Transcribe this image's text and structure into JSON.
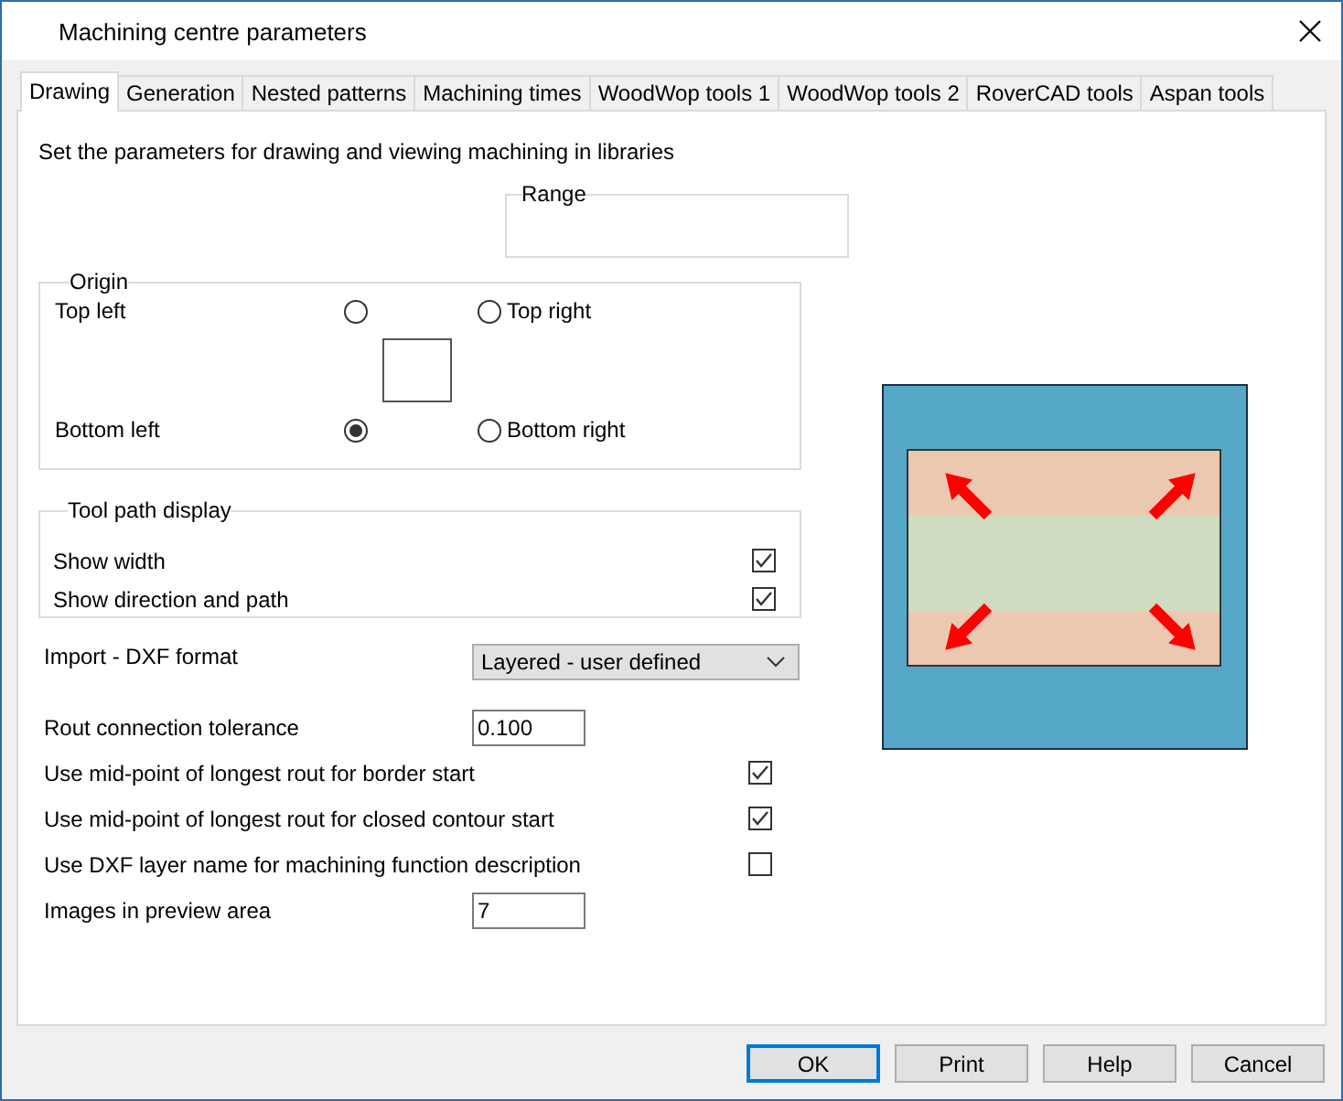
{
  "window": {
    "title": "Machining centre parameters"
  },
  "tabs": [
    {
      "label": "Drawing",
      "selected": true
    },
    {
      "label": "Generation",
      "selected": false
    },
    {
      "label": "Nested patterns",
      "selected": false
    },
    {
      "label": "Machining times",
      "selected": false
    },
    {
      "label": "WoodWop tools 1",
      "selected": false
    },
    {
      "label": "WoodWop tools 2",
      "selected": false
    },
    {
      "label": "RoverCAD tools",
      "selected": false
    },
    {
      "label": "Aspan tools",
      "selected": false
    }
  ],
  "description": "Set the parameters for drawing and viewing machining in libraries",
  "range": {
    "title": "Range"
  },
  "origin": {
    "title": "Origin",
    "options": [
      {
        "label": "Top left",
        "kind": "label-before",
        "selected": false
      },
      {
        "label": "Top right",
        "kind": "label-after",
        "selected": false
      },
      {
        "label": "Bottom left",
        "kind": "label-before",
        "selected": true
      },
      {
        "label": "Bottom right",
        "kind": "label-after",
        "selected": false
      }
    ]
  },
  "tool_path_display": {
    "title": "Tool path display",
    "items": [
      {
        "label": "Show width",
        "checked": true
      },
      {
        "label": "Show direction and path",
        "checked": true
      }
    ]
  },
  "settings": [
    {
      "kind": "dropdown",
      "label": "Import - DXF format",
      "value": "Layered - user defined"
    },
    {
      "kind": "input",
      "label": "Rout connection tolerance",
      "value": "0.100"
    },
    {
      "kind": "checkbox",
      "label": "Use mid-point of longest rout for border start",
      "checked": true
    },
    {
      "kind": "checkbox",
      "label": "Use mid-point of longest rout for closed contour start",
      "checked": true
    },
    {
      "kind": "checkbox",
      "label": "Use DXF layer name for machining function description",
      "checked": false
    },
    {
      "kind": "input",
      "label": "Images in preview area",
      "value": "7"
    }
  ],
  "buttons": [
    {
      "label": "OK",
      "default": true
    },
    {
      "label": "Print",
      "default": false
    },
    {
      "label": "Help",
      "default": false
    },
    {
      "label": "Cancel",
      "default": false
    }
  ]
}
